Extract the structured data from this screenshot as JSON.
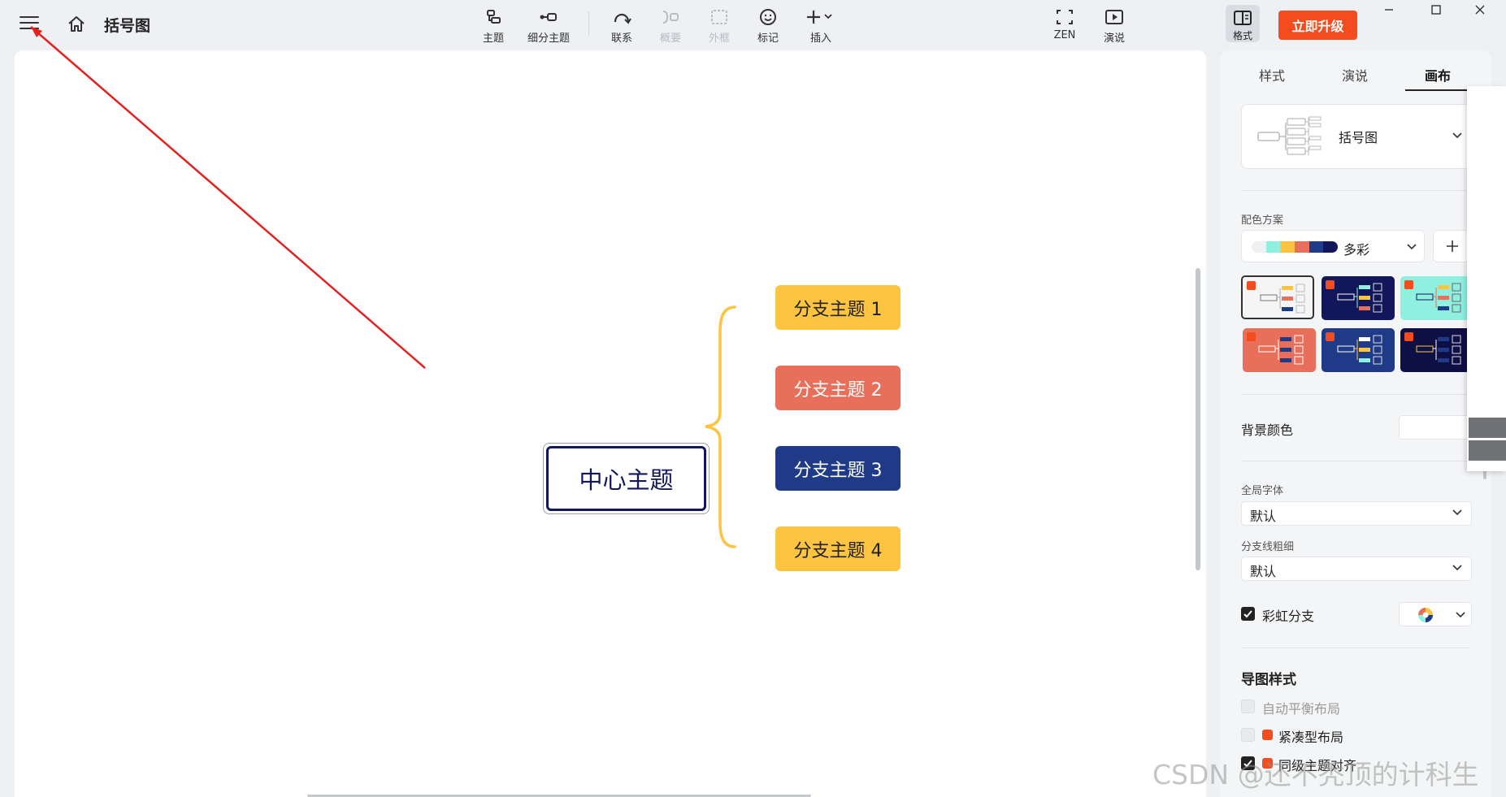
{
  "header": {
    "doc_title": "括号图"
  },
  "toolbar": {
    "topic": "主题",
    "subtopic": "细分主题",
    "relationship": "联系",
    "summary": "概要",
    "boundary": "外框",
    "marker": "标记",
    "insert": "插入",
    "zen": "ZEN",
    "present": "演说",
    "format": "格式",
    "upgrade": "立即升级"
  },
  "canvas": {
    "central_topic": "中心主题",
    "branches": [
      "分支主题 1",
      "分支主题 2",
      "分支主题 3",
      "分支主题 4"
    ]
  },
  "panel": {
    "tabs": [
      "样式",
      "演说",
      "画布"
    ],
    "active_tab": "画布",
    "layout_name": "括号图",
    "color_scheme_label": "配色方案",
    "color_scheme_value": "多彩",
    "background_color_label": "背景颜色",
    "global_font_label": "全局字体",
    "global_font_value": "默认",
    "branch_width_label": "分支线粗细",
    "branch_width_value": "默认",
    "rainbow_branch_label": "彩虹分支",
    "map_style_title": "导图样式",
    "auto_balance_label": "自动平衡布局",
    "compact_label": "紧凑型布局",
    "align_label": "同级主题对齐"
  },
  "watermark": "CSDN @还不秃顶的计科生",
  "colors": {
    "accent": "#f24c1f",
    "navy": "#12165a",
    "branch_yellow": "#fcc440",
    "branch_coral": "#e8705a",
    "branch_blue": "#1f3b87",
    "annotation_red": "#e32222"
  }
}
